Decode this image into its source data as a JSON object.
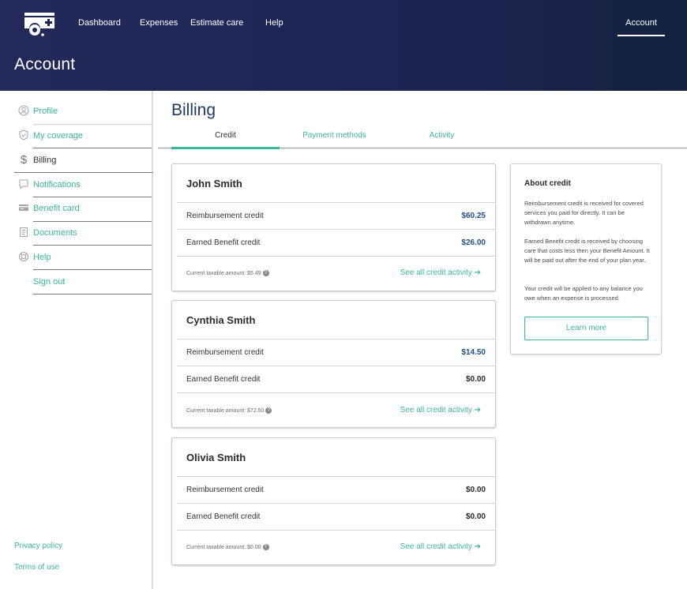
{
  "header": {
    "nav": [
      "Dashboard",
      "Expenses",
      "Estimate care",
      "Help"
    ],
    "account_tab": "Account",
    "page_title": "Account"
  },
  "sidebar": {
    "items": [
      {
        "label": "Profile",
        "icon": "profile-icon"
      },
      {
        "label": "My coverage",
        "icon": "shield-check-icon"
      },
      {
        "label": "Billing",
        "icon": "dollar-icon",
        "active": true
      },
      {
        "label": "Notifications",
        "icon": "chat-bubble-icon"
      },
      {
        "label": "Benefit card",
        "icon": "credit-card-icon"
      },
      {
        "label": "Documents",
        "icon": "document-icon"
      },
      {
        "label": "Help",
        "icon": "lifebuoy-icon"
      },
      {
        "label": "Sign out"
      }
    ],
    "footer_links": [
      "Privacy policy",
      "Terms of use"
    ]
  },
  "main": {
    "title": "Billing",
    "tabs": [
      "Credit",
      "Payment methods",
      "Activity"
    ],
    "active_tab": "Credit",
    "cards": [
      {
        "name": "John Smith",
        "rows": [
          {
            "label": "Reimbursement credit",
            "value": "$60.25",
            "highlight": true
          },
          {
            "label": "Earned Benefit credit",
            "value": "$26.00",
            "highlight": true
          }
        ],
        "taxable": "Current taxable amount: $5.49",
        "activity_link": "See all credit activity"
      },
      {
        "name": "Cynthia Smith",
        "rows": [
          {
            "label": "Reimbursement credit",
            "value": "$14.50",
            "highlight": true
          },
          {
            "label": "Earned Benefit credit",
            "value": "$0.00",
            "highlight": false
          }
        ],
        "taxable": "Current taxable amount: $72.50",
        "activity_link": "See all credit activity"
      },
      {
        "name": "Olivia Smith",
        "rows": [
          {
            "label": "Reimbursement credit",
            "value": "$0.00",
            "highlight": false
          },
          {
            "label": "Earned Benefit credit",
            "value": "$0.00",
            "highlight": false
          }
        ],
        "taxable": "Current taxable amount: $0.00",
        "activity_link": "See all credit activity"
      }
    ],
    "about": {
      "heading": "About credit",
      "paragraphs": [
        "Reimbursement credit is received for covered services you paid for directly. It can be withdrawn anytime.",
        "Earned Benefit credit is received by choosing care that costs less then your Benefit Amount. It will be paid out after the end of your plan year.",
        "Your credit will be applied to any balance you owe when an expense is processed."
      ],
      "button": "Learn more"
    }
  },
  "colors": {
    "accent": "#3bb89a",
    "value_blue": "#1f4f8a",
    "value_dark": "#2b2b2b",
    "header_bg": "#1d2554"
  }
}
